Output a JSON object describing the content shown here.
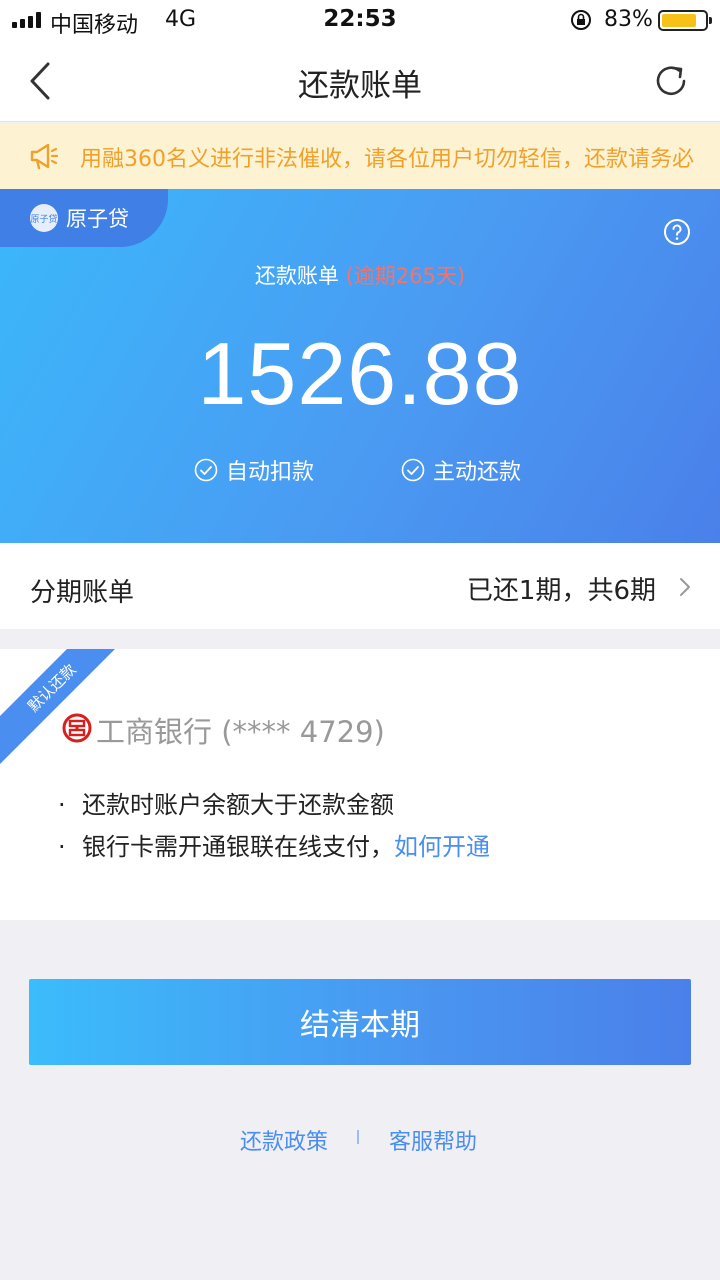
{
  "status_bar": {
    "carrier": "中国移动",
    "network": "4G",
    "time": "22:53",
    "battery": "83%",
    "battery_level": 0.83
  },
  "nav": {
    "title": "还款账单",
    "back_icon": "chevron-left-icon",
    "refresh_icon": "refresh-icon"
  },
  "notice": {
    "icon": "megaphone-icon",
    "text": "用融360名义进行非法催收，请各位用户切勿轻信，还款请务必"
  },
  "hero": {
    "product_logo_text": "原子贷",
    "product_name": "原子贷",
    "bill_title": "还款账单",
    "overdue": "(逾期265天)",
    "amount": "1526.88",
    "auto_label": "自动扣款",
    "manual_label": "主动还款"
  },
  "installment": {
    "label": "分期账单",
    "status": "已还1期，共6期"
  },
  "bank": {
    "ribbon": "默认还款",
    "name": "工商银行 (**** 4729)",
    "note1": "还款时账户余额大于还款金额",
    "note2": "银行卡需开通银联在线支付，",
    "note2_link": "如何开通"
  },
  "actions": {
    "pay_label": "结清本期"
  },
  "footer": {
    "policy": "还款政策",
    "support": "客服帮助"
  },
  "colors": {
    "accent": "#4a8ef0",
    "notice_text": "#f0a02b",
    "overdue": "#f5736a"
  }
}
